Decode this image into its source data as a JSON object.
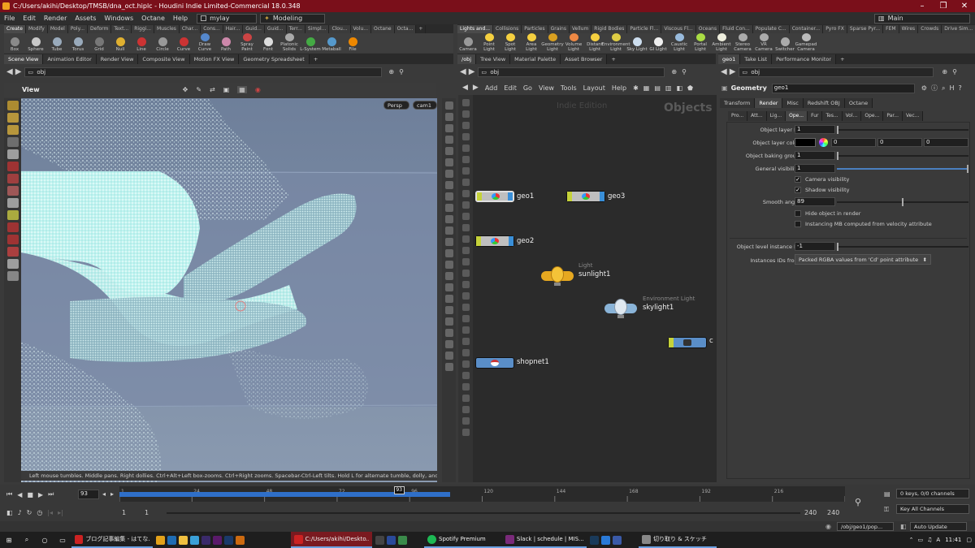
{
  "window": {
    "title": "C:/Users/akihi/Desktop/TMSB/dna_oct.hiplc - Houdini Indie Limited-Commercial 18.0.348",
    "controls": [
      "–",
      "❐",
      "✕"
    ]
  },
  "menu": {
    "items": [
      "File",
      "Edit",
      "Render",
      "Assets",
      "Windows",
      "Octane",
      "Help"
    ],
    "desktop": "mylay",
    "workspace": "Modeling",
    "main": "Main"
  },
  "shelf_left": {
    "tabs": [
      "Create",
      "Modify",
      "Model",
      "Poly...",
      "Deform",
      "Text...",
      "Riggi...",
      "Muscles",
      "Char...",
      "Cons...",
      "Hair...",
      "Guid...",
      "Guid...",
      "Terr...",
      "Simpl...",
      "Clou...",
      "Volu...",
      "Octane",
      "Octa..."
    ],
    "tools": [
      {
        "label": "Box",
        "icon": "box-icon",
        "color": "#8a8a8a"
      },
      {
        "label": "Sphere",
        "icon": "sphere-icon",
        "color": "#c8c8c8"
      },
      {
        "label": "Tube",
        "icon": "tube-icon",
        "color": "#9ab"
      },
      {
        "label": "Torus",
        "icon": "torus-icon",
        "color": "#9ab"
      },
      {
        "label": "Grid",
        "icon": "grid-icon",
        "color": "#777"
      },
      {
        "label": "Null",
        "icon": "null-icon",
        "color": "#e0b030"
      },
      {
        "label": "Line",
        "icon": "line-icon",
        "color": "#c33"
      },
      {
        "label": "Circle",
        "icon": "circle-icon",
        "color": "#999"
      },
      {
        "label": "Curve",
        "icon": "curve-icon",
        "color": "#c33"
      },
      {
        "label": "Draw Curve",
        "icon": "draw-curve-icon",
        "color": "#58c"
      },
      {
        "label": "Path",
        "icon": "path-icon",
        "color": "#c8a"
      },
      {
        "label": "Spray Paint",
        "icon": "spray-paint-icon",
        "color": "#c44"
      },
      {
        "label": "Font",
        "icon": "font-icon",
        "color": "#ddd"
      },
      {
        "label": "Platonic Solids",
        "icon": "platonic-icon",
        "color": "#aaa"
      },
      {
        "label": "L-System",
        "icon": "lsystem-icon",
        "color": "#4a4"
      },
      {
        "label": "Metaball",
        "icon": "metaball-icon",
        "color": "#59c"
      },
      {
        "label": "File",
        "icon": "file-icon",
        "color": "#e80"
      }
    ]
  },
  "shelf_right": {
    "tabs": [
      "Lights and...",
      "Collisions",
      "Particles",
      "Grains",
      "Vellum",
      "Rigid Bodies",
      "Particle Fl...",
      "Viscous Fl...",
      "Oceans",
      "Fluid Con...",
      "Populate C...",
      "Container...",
      "Pyro FX",
      "Sparse Pyr...",
      "FEM",
      "Wires",
      "Crowds",
      "Drive Sim..."
    ],
    "tools": [
      {
        "label": "Camera",
        "icon": "camera-icon",
        "color": "#999"
      },
      {
        "label": "Point Light",
        "icon": "point-light-icon",
        "color": "#f5d040"
      },
      {
        "label": "Spot Light",
        "icon": "spot-light-icon",
        "color": "#f5d040"
      },
      {
        "label": "Area Light",
        "icon": "area-light-icon",
        "color": "#f5d040"
      },
      {
        "label": "Geometry Light",
        "icon": "geometry-light-icon",
        "color": "#d9a020"
      },
      {
        "label": "Volume Light",
        "icon": "volume-light-icon",
        "color": "#e84"
      },
      {
        "label": "Distant Light",
        "icon": "distant-light-icon",
        "color": "#f5d040"
      },
      {
        "label": "Environment Light",
        "icon": "environment-light-icon",
        "color": "#dc4"
      },
      {
        "label": "Sky Light",
        "icon": "sky-light-icon",
        "color": "#cde"
      },
      {
        "label": "GI Light",
        "icon": "gi-light-icon",
        "color": "#eee"
      },
      {
        "label": "Caustic Light",
        "icon": "caustic-light-icon",
        "color": "#9bd"
      },
      {
        "label": "Portal Light",
        "icon": "portal-light-icon",
        "color": "#ad4"
      },
      {
        "label": "Ambient Light",
        "icon": "ambient-light-icon",
        "color": "#eed"
      },
      {
        "label": "Stereo Camera",
        "icon": "stereo-camera-icon",
        "color": "#aaa"
      },
      {
        "label": "VR Camera",
        "icon": "vr-camera-icon",
        "color": "#aaa"
      },
      {
        "label": "Switcher",
        "icon": "switcher-icon",
        "color": "#aaa"
      },
      {
        "label": "Gamepad Camera",
        "icon": "gamepad-camera-icon",
        "color": "#bbb"
      }
    ]
  },
  "left_pane": {
    "tabs": [
      "Scene View",
      "Animation Editor",
      "Render View",
      "Composite View",
      "Motion FX View",
      "Geometry Spreadsheet"
    ],
    "path": "obj",
    "view_label": "View",
    "persp": "Persp",
    "cam": "cam1",
    "status": "Left mouse tumbles. Middle pans. Right dollies. Ctrl+Alt+Left box-zooms. Ctrl+Right zooms. Spacebar-Ctrl-Left tilts. Hold L for alternate tumble, dolly, and zoom."
  },
  "mid_pane": {
    "tabs": [
      "/obj",
      "Tree View",
      "Material Palette",
      "Asset Browser"
    ],
    "path": "obj",
    "menu": [
      "Add",
      "Edit",
      "Go",
      "View",
      "Tools",
      "Layout",
      "Help"
    ],
    "watermark": "Indie Edition",
    "context": "Objects",
    "nodes": [
      {
        "name": "geo1",
        "type": "geo",
        "selected": true
      },
      {
        "name": "geo3",
        "type": "geo"
      },
      {
        "name": "geo2",
        "type": "geo"
      },
      {
        "name": "sunlight1",
        "type": "light",
        "subtitle": "Light"
      },
      {
        "name": "skylight1",
        "type": "envlight",
        "subtitle": "Environment Light"
      },
      {
        "name": "shopnet1",
        "type": "shopnet"
      },
      {
        "name": "c",
        "type": "cam"
      }
    ]
  },
  "parm_pane": {
    "tabs": [
      "geo1",
      "Take List",
      "Performance Monitor"
    ],
    "path": "obj",
    "node_type": "Geometry",
    "node_name": "geo1",
    "main_tabs": [
      "Transform",
      "Render",
      "Misc",
      "Redshift OBJ",
      "Octane"
    ],
    "sub_tabs": [
      "Pro...",
      "Att...",
      "Lig...",
      "Ope...",
      "Fur",
      "Tes...",
      "Vol...",
      "Ope...",
      "Par...",
      "Vec..."
    ],
    "params": {
      "layer_id_label": "Object layer ID",
      "layer_id": "1",
      "layer_color_label": "Object layer color",
      "color_r": "0",
      "color_g": "0",
      "color_b": "0",
      "baking_label": "Object baking group",
      "baking": "1",
      "general_vis_label": "General visibility",
      "general_vis": "1",
      "camera_vis_label": "Camera visibility",
      "shadow_vis_label": "Shadow visibility",
      "smooth_label": "Smooth angle",
      "smooth": "89",
      "hide_label": "Hide object in render",
      "instancing_label": "Instancing MB computed from velocity attribute",
      "instance_id_label": "Object level instance ID",
      "instance_id": "-1",
      "instance_ids_label": "Instances IDs from",
      "instance_ids": "Packed RGBA values from 'Cd' point attribute"
    }
  },
  "timeline": {
    "frame": "93",
    "marker": "93",
    "ticks": [
      "1",
      "24",
      "48",
      "72",
      "96",
      "120",
      "144",
      "168",
      "192",
      "216",
      "2"
    ],
    "start": "1",
    "start2": "1",
    "end": "240",
    "end2": "240",
    "keys": "0 keys, 0/0 channels",
    "key_all": "Key All Channels",
    "auto_update": "Auto Update",
    "path": "/obj/geo1/pop..."
  },
  "taskbar": {
    "items": [
      {
        "label": "ブログ記事編集 - はてな...",
        "color": "#c22"
      },
      {
        "label": "C:/Users/akihi/Deskto...",
        "color": "#c22"
      },
      {
        "label": "Spotify Premium",
        "color": "#1db954"
      },
      {
        "label": "Slack | schedule | MIS...",
        "color": "#7a2a7a"
      },
      {
        "label": "切り取り & スケッチ",
        "color": "#888"
      }
    ],
    "time": "11:41"
  }
}
